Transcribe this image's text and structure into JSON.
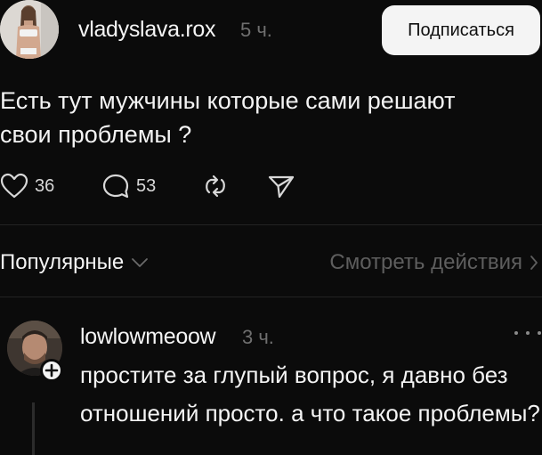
{
  "post": {
    "author": "vladyslava.rox",
    "time": "5 ч.",
    "follow_label": "Подписаться",
    "text": "Есть тут мужчины которые сами решают свои проблемы ?",
    "likes": "36",
    "replies": "53"
  },
  "icons": {
    "like": "heart-icon",
    "reply": "comment-bubble-icon",
    "repost": "repost-icon",
    "share": "send-icon",
    "more": "more-dots-icon",
    "follow_badge": "plus-icon",
    "chevron": "chevron-icon"
  },
  "filters": {
    "sort_label": "Популярные",
    "view_activity_label": "Смотреть действия"
  },
  "comment": {
    "author": "lowlowmeoow",
    "time": "3 ч.",
    "text": "простите за глупый вопрос, я давно без отношений просто. а что такое проблемы?"
  },
  "colors": {
    "background": "#0b0b0b",
    "text": "#f4f4f4",
    "muted": "#6f6f6f",
    "button": "#f4f4f4"
  }
}
